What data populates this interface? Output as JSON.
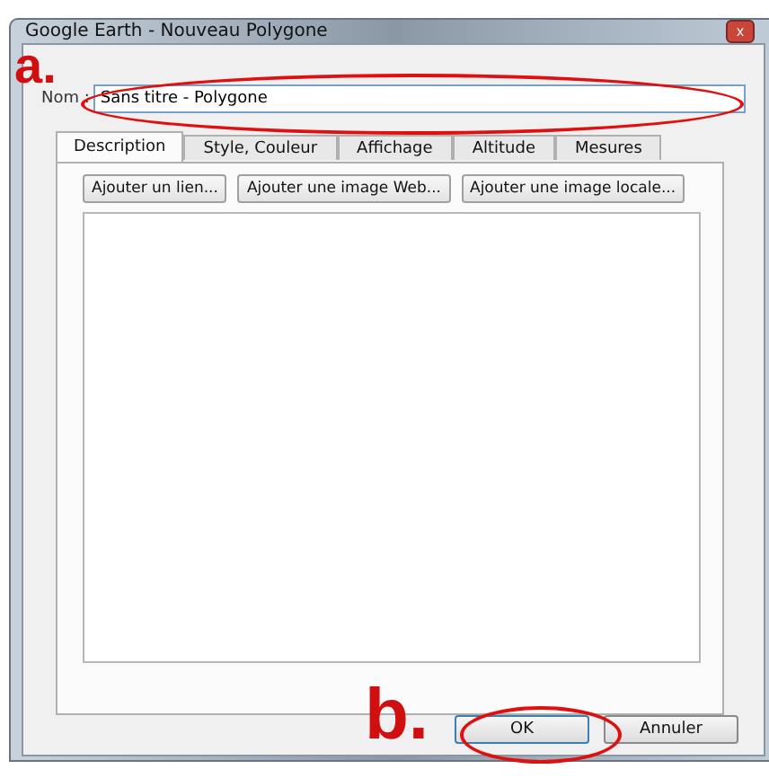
{
  "window": {
    "title": "Google Earth - Nouveau Polygone",
    "close_icon": "x"
  },
  "name_field": {
    "label": "Nom :",
    "value": "Sans titre - Polygone"
  },
  "tabs": [
    {
      "label": "Description",
      "selected": true
    },
    {
      "label": "Style, Couleur",
      "selected": false
    },
    {
      "label": "Affichage",
      "selected": false
    },
    {
      "label": "Altitude",
      "selected": false
    },
    {
      "label": "Mesures",
      "selected": false
    }
  ],
  "description_buttons": [
    "Ajouter un lien...",
    "Ajouter une image Web...",
    "Ajouter une image locale..."
  ],
  "buttons": [
    {
      "label": "OK",
      "default": true
    },
    {
      "label": "Annuler",
      "default": false
    }
  ],
  "annotations": [
    {
      "label": "a."
    },
    {
      "label": "b."
    }
  ]
}
